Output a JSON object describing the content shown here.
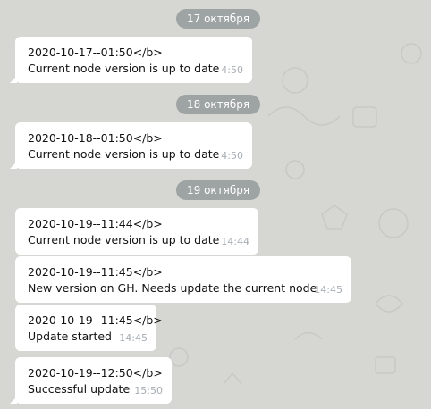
{
  "dates": [
    "17 октября",
    "18 октября",
    "19 октября"
  ],
  "messages": [
    {
      "header": "2020-10-17--01:50</b>",
      "body": "Current node version is up to date",
      "time": "4:50"
    },
    {
      "header": "2020-10-18--01:50</b>",
      "body": "Current node version is up to date",
      "time": "4:50"
    },
    {
      "header": "2020-10-19--11:44</b>",
      "body": "Current node version is up to date",
      "time": "14:44"
    },
    {
      "header": "2020-10-19--11:45</b>",
      "body": "New version on GH. Needs update the current node",
      "time": "14:45"
    },
    {
      "header": "2020-10-19--11:45</b>",
      "body": "Update started",
      "time": "14:45"
    },
    {
      "header": "2020-10-19--12:50</b>",
      "body": "Successful update",
      "time": "15:50"
    }
  ],
  "colors": {
    "chat_background": "#d6d7d3",
    "bubble": "#ffffff",
    "date_pill": "#9ea4a3",
    "time_text": "#a7adb3"
  }
}
